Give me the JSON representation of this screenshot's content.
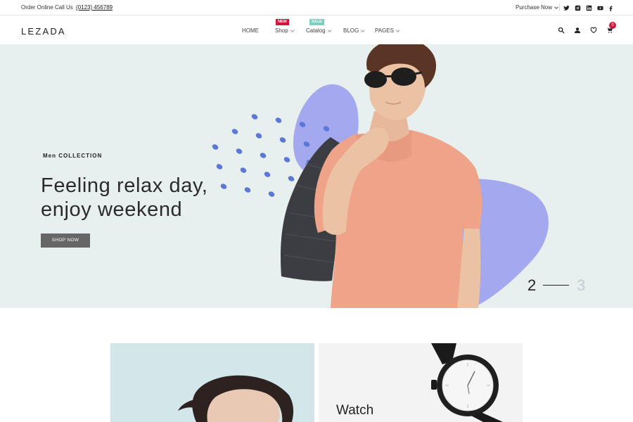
{
  "topbar": {
    "order_text": "Order Online Call Us",
    "phone": "(0123) 456789",
    "purchase_label": "Purchase Now",
    "social_icons": [
      "twitter-icon",
      "instagram-icon",
      "linkedin-icon",
      "youtube-icon",
      "facebook-icon"
    ]
  },
  "header": {
    "logo": "LEZADA",
    "nav": [
      {
        "label": "HOME",
        "has_dropdown": false
      },
      {
        "label": "Shop",
        "badge": "NEW",
        "has_dropdown": true
      },
      {
        "label": "Catalog",
        "badge": "SALE",
        "has_dropdown": true
      },
      {
        "label": "BLOG",
        "has_dropdown": true
      },
      {
        "label": "PAGES",
        "has_dropdown": true
      }
    ],
    "icons": [
      "search-icon",
      "user-icon",
      "heart-icon",
      "cart-icon"
    ],
    "cart_count": "0"
  },
  "hero": {
    "subtitle": "Men COLLECTION",
    "title_line1": "Feeling relax day,",
    "title_line2": "enjoy weekend",
    "button": "SHOP NOW",
    "slide_current": "2",
    "slide_next": "3"
  },
  "promo": {
    "right_label": "Watch"
  },
  "colors": {
    "accent_red": "#d0163c",
    "sale_teal": "#7ecfc0",
    "hero_bg": "#e7efef",
    "blob_purple": "#a4a8ee",
    "dots_blue": "#5b78d6",
    "button_gray": "#666666"
  }
}
